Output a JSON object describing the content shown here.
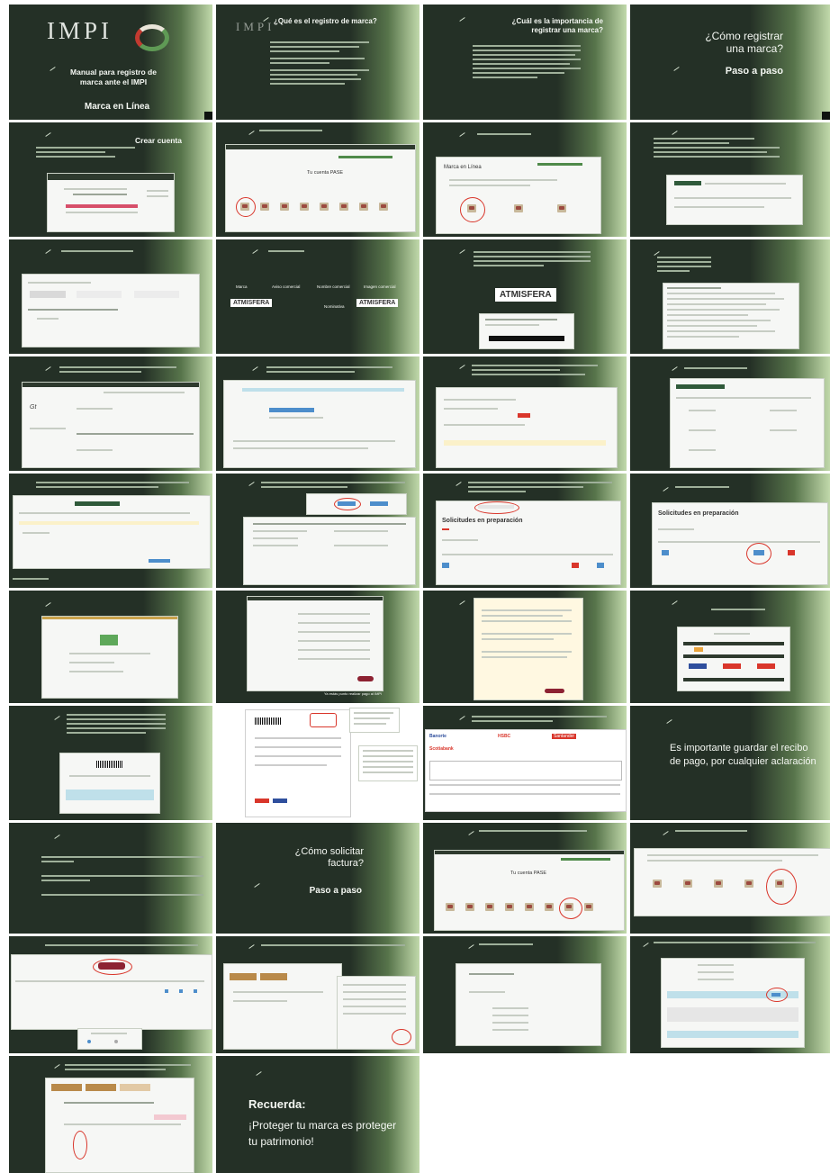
{
  "slides": {
    "s1": {
      "logo": "IMPI",
      "title": "Manual para registro de marca ante el IMPI",
      "subtitle": "Marca en Línea"
    },
    "s2": {
      "title": "¿Qué es el registro de marca?"
    },
    "s3": {
      "title": "¿Cuál es la importancia de registrar una marca?"
    },
    "s4": {
      "title": "¿Cómo registrar una marca?",
      "subtitle": "Paso a paso"
    },
    "s5": {
      "title": "Crear cuenta"
    },
    "s6": {
      "portal_title": "Tu cuenta PASE"
    },
    "s7": {
      "portal_title": "Marca en Línea"
    },
    "s10_types": {
      "a": "Marca",
      "b": "Aviso comercial",
      "c": "Nombre comercial",
      "d": "Imagen comercial",
      "e": "ATMISFERA",
      "f": "Nominativa",
      "g": "ATMISFERA"
    },
    "s11": {
      "logo": "ATMISFERA"
    },
    "s18": {
      "portal_title": "Solicitudes en preparación"
    },
    "s22": {
      "caption": "Ya estás punto realizar pago al IMPI"
    },
    "s28": {
      "text": "Es importante guardar el recibo de pago, por cualquier aclaración"
    },
    "s29": {
      "title": "¿Cómo solicitar factura?",
      "subtitle": "Paso a paso"
    },
    "s30": {
      "portal_title": "Tu cuenta PASE"
    },
    "s35": {
      "title": "Recuerda:",
      "text": "¡Proteger tu marca es proteger tu patrimonio!"
    },
    "banks": {
      "a": "Banorte",
      "b": "HSBC",
      "c": "Santander",
      "d": "Scotiabank"
    }
  },
  "colors": {
    "slide_bg": "#243026",
    "accent_green": "#6fa56a",
    "highlight_red": "#d9362b",
    "button_wine": "#8d2232"
  }
}
